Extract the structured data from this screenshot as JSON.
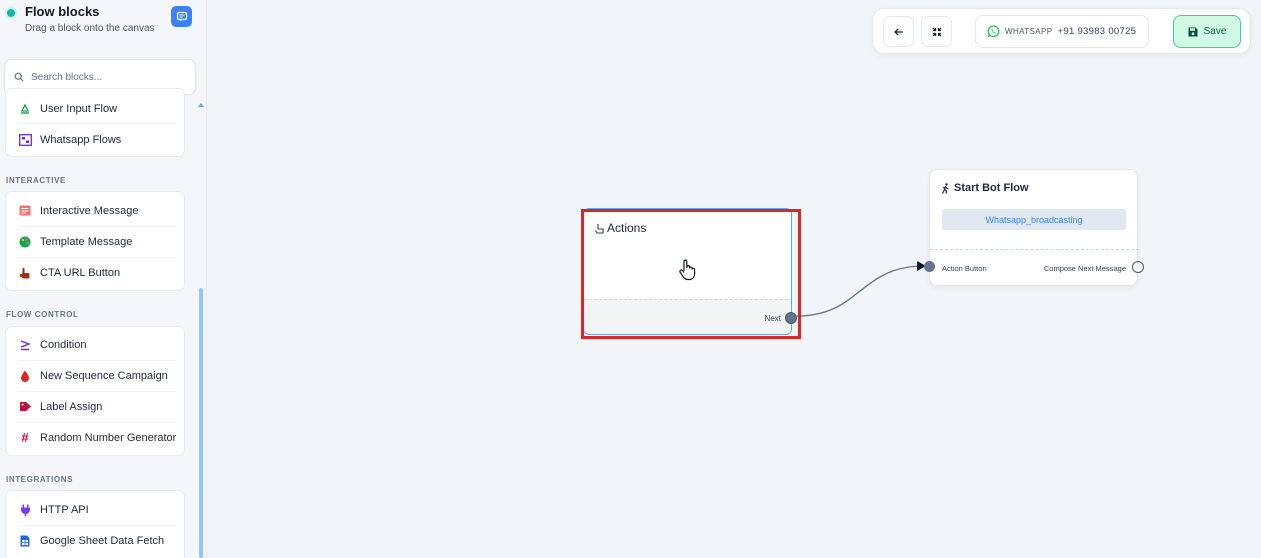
{
  "sidebar": {
    "title": "Flow blocks",
    "subtitle": "Drag a block onto the canvas",
    "search_placeholder": "Search blocks...",
    "group_top": [
      {
        "label": "User Input Flow",
        "icon": "user-input-icon"
      },
      {
        "label": "Whatsapp Flows",
        "icon": "whatsapp-flows-icon"
      }
    ],
    "sections": [
      {
        "name": "INTERACTIVE",
        "items": [
          {
            "label": "Interactive Message",
            "icon": "interactive-message-icon"
          },
          {
            "label": "Template Message",
            "icon": "palette-icon"
          },
          {
            "label": "CTA URL Button",
            "icon": "pointer-hand-icon"
          }
        ]
      },
      {
        "name": "FLOW CONTROL",
        "items": [
          {
            "label": "Condition",
            "icon": "greater-equal-icon"
          },
          {
            "label": "New Sequence Campaign",
            "icon": "drop-icon"
          },
          {
            "label": "Label Assign",
            "icon": "tag-icon"
          },
          {
            "label": "Random Number Generator",
            "icon": "hash-icon"
          }
        ]
      },
      {
        "name": "INTEGRATIONS",
        "items": [
          {
            "label": "HTTP API",
            "icon": "plug-icon"
          },
          {
            "label": "Google Sheet Data Fetch",
            "icon": "spreadsheet-icon"
          }
        ]
      }
    ]
  },
  "toolbar": {
    "whatsapp_label": "WHATSAPP",
    "whatsapp_number": "+91 93983 00725",
    "save_label": "Save"
  },
  "nodes": {
    "actions": {
      "title": "Actions",
      "next_label": "Next"
    },
    "start": {
      "title": "Start Bot Flow",
      "tag": "Whatsapp_broadcasting",
      "input_label": "Action Button",
      "output_label": "Compose Next Message"
    }
  },
  "colors": {
    "accent": "#3b82f6",
    "highlight": "#dc2626",
    "save_bg": "#d1fae5",
    "whatsapp": "#22c55e"
  }
}
